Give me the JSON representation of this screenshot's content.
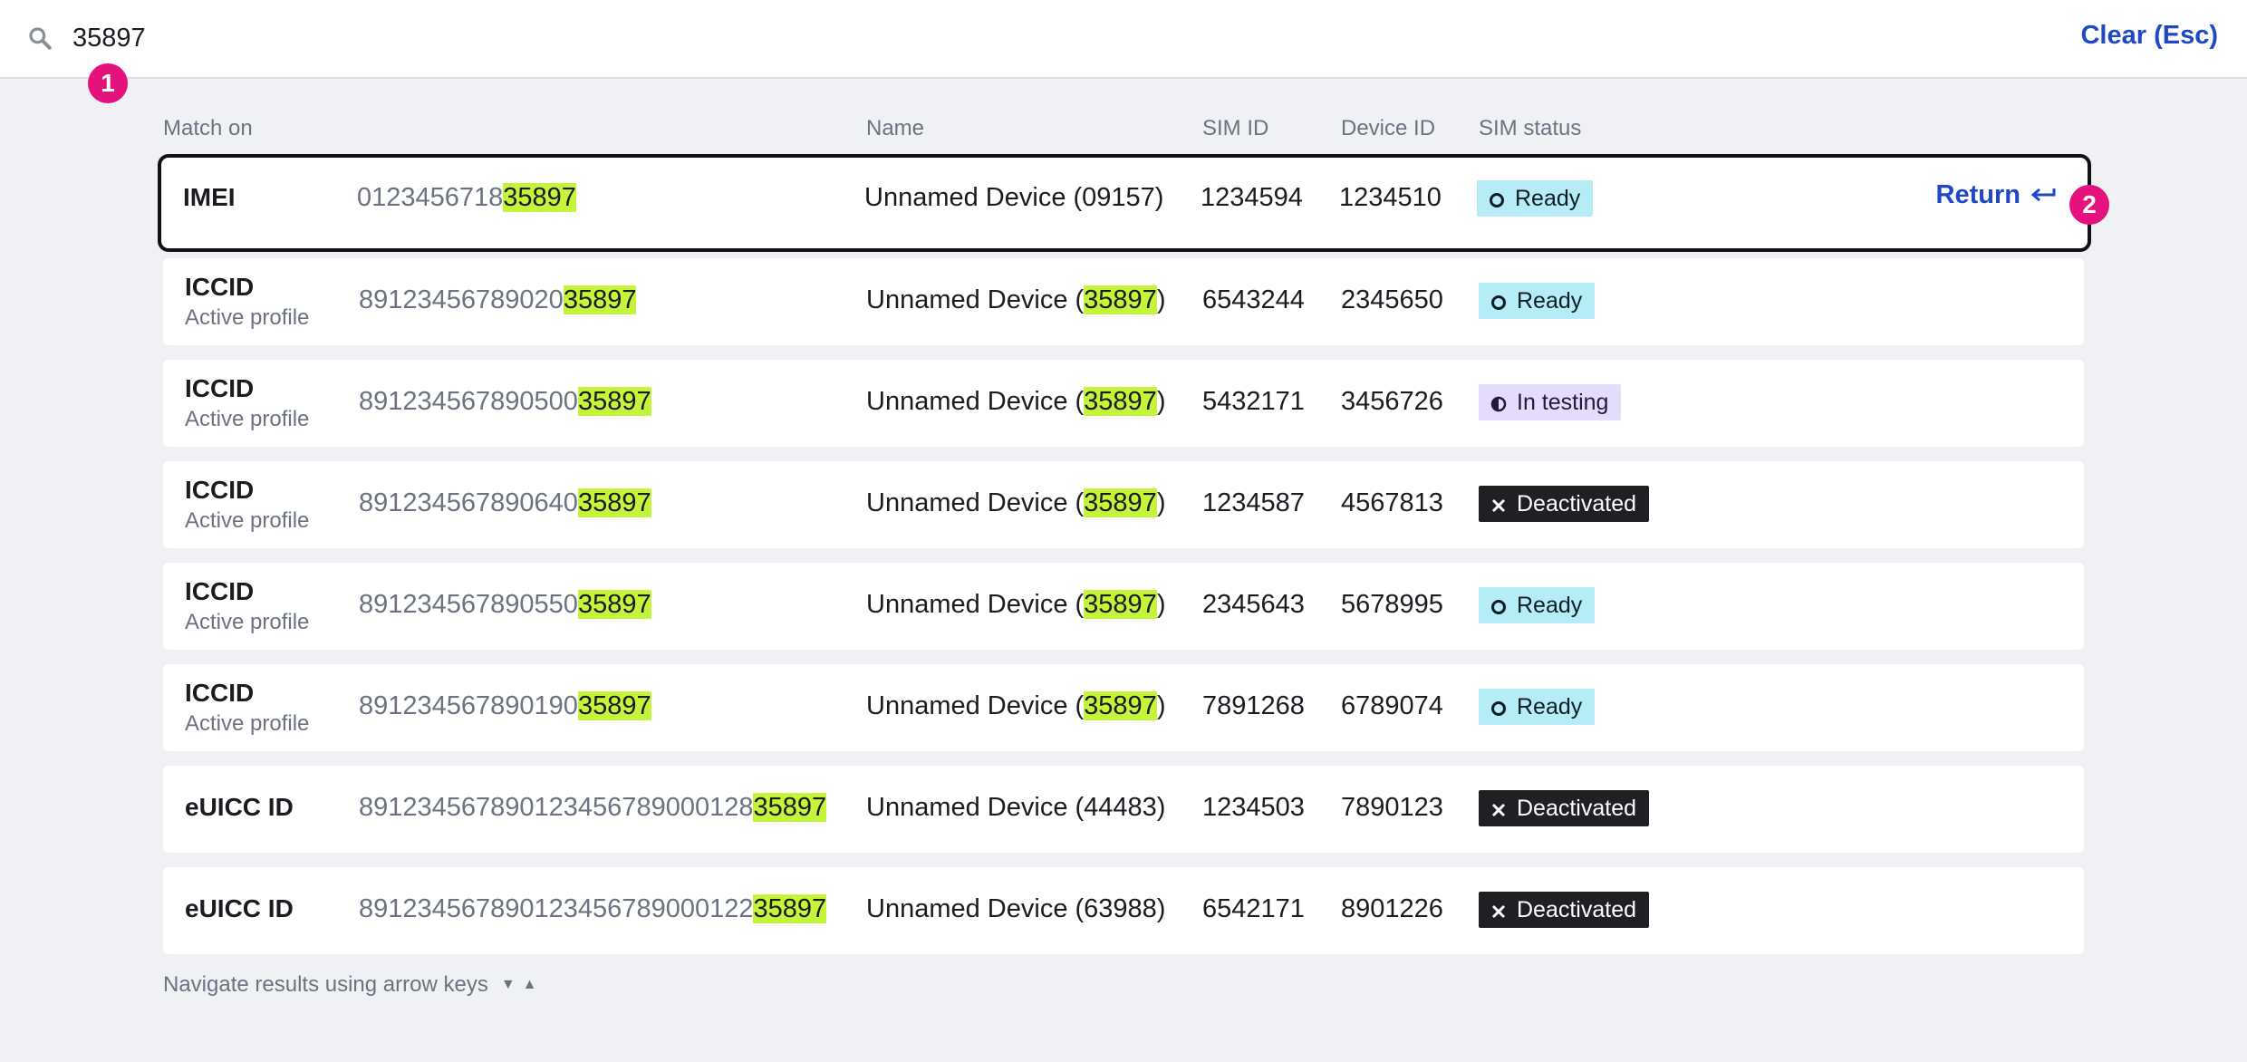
{
  "search": {
    "query": "35897",
    "clear_label": "Clear (Esc)"
  },
  "markers": [
    "1",
    "2"
  ],
  "columns": {
    "match_on": "Match on",
    "name": "Name",
    "sim_id": "SIM ID",
    "device_id": "Device ID",
    "sim_status": "SIM status"
  },
  "results": [
    {
      "type": "IMEI",
      "sub": "",
      "prefix": "0123456718",
      "match": "35897",
      "name_prefix": "Unnamed Device (09157)",
      "name_match": "",
      "name_suffix": "",
      "sim_id": "1234594",
      "device_id": "1234510",
      "status": "Ready",
      "action": "Return"
    },
    {
      "type": "ICCID",
      "sub": "Active profile",
      "prefix": "89123456789020",
      "match": "35897",
      "name_prefix": "Unnamed Device (",
      "name_match": "35897",
      "name_suffix": ")",
      "sim_id": "6543244",
      "device_id": "2345650",
      "status": "Ready"
    },
    {
      "type": "ICCID",
      "sub": "Active profile",
      "prefix": "891234567890500",
      "match": "35897",
      "name_prefix": "Unnamed Device (",
      "name_match": "35897",
      "name_suffix": ")",
      "sim_id": "5432171",
      "device_id": "3456726",
      "status": "In testing"
    },
    {
      "type": "ICCID",
      "sub": "Active profile",
      "prefix": "891234567890640",
      "match": "35897",
      "name_prefix": "Unnamed Device (",
      "name_match": "35897",
      "name_suffix": ")",
      "sim_id": "1234587",
      "device_id": "4567813",
      "status": "Deactivated"
    },
    {
      "type": "ICCID",
      "sub": "Active profile",
      "prefix": "891234567890550",
      "match": "35897",
      "name_prefix": "Unnamed Device (",
      "name_match": "35897",
      "name_suffix": ")",
      "sim_id": "2345643",
      "device_id": "5678995",
      "status": "Ready"
    },
    {
      "type": "ICCID",
      "sub": "Active profile",
      "prefix": "891234567890190",
      "match": "35897",
      "name_prefix": "Unnamed Device (",
      "name_match": "35897",
      "name_suffix": ")",
      "sim_id": "7891268",
      "device_id": "6789074",
      "status": "Ready"
    },
    {
      "type": "eUICC ID",
      "sub": "",
      "prefix": "891234567890123456789000128",
      "match": "35897",
      "name_prefix": "Unnamed Device (44483)",
      "name_match": "",
      "name_suffix": "",
      "sim_id": "1234503",
      "device_id": "7890123",
      "status": "Deactivated"
    },
    {
      "type": "eUICC ID",
      "sub": "",
      "prefix": "891234567890123456789000122",
      "match": "35897",
      "name_prefix": "Unnamed Device (63988)",
      "name_match": "",
      "name_suffix": "",
      "sim_id": "6542171",
      "device_id": "8901226",
      "status": "Deactivated"
    }
  ],
  "footer": {
    "hint": "Navigate results using arrow keys"
  },
  "colors": {
    "accent": "#1f48c6",
    "highlight": "#c5f53a",
    "marker": "#e5127d",
    "ready": "#b5ecf6",
    "testing": "#e4dcfb",
    "deactivated": "#1f2023"
  },
  "icons": {
    "search": "search-icon",
    "ready": "ring-icon",
    "testing": "half-circle-icon",
    "deactivated": "x-icon",
    "return": "return-arrow-icon"
  }
}
